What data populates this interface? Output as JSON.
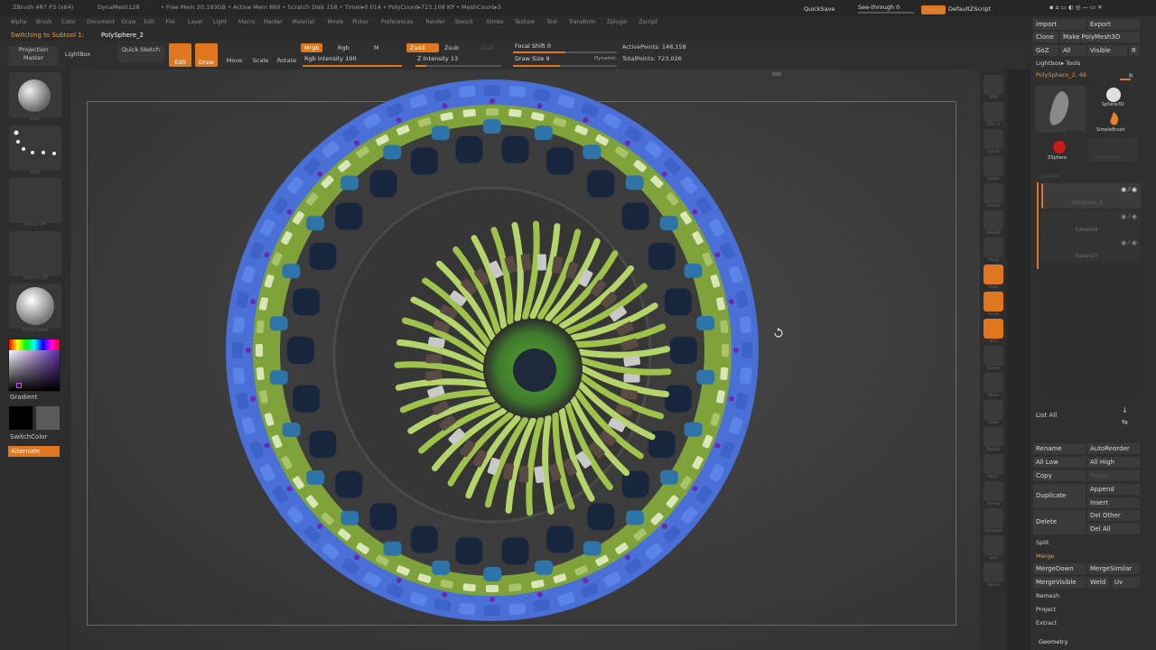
{
  "titlebar": {
    "app": "ZBrush 4R7 P3 (x64)",
    "dynamesh": "DynaMesh128",
    "free_mem": "• Free Mem 20.193GB • Active Mem 860 • Scratch Disk 158 • Timer▸0.014 • PolyCount▸723.108 KP • MeshCount▸3",
    "quicksave": "QuickSave",
    "see_through": "See-through 0",
    "menus": "Menus",
    "script": "DefaultZScript"
  },
  "menubar": [
    "Alpha",
    "Brush",
    "Color",
    "Document",
    "Draw",
    "Edit",
    "File",
    "Layer",
    "Light",
    "Macro",
    "Marker",
    "Material",
    "Movie",
    "Picker",
    "Preferences",
    "Render",
    "Stencil",
    "Stroke",
    "Texture",
    "Tool",
    "Transform",
    "Zplugin",
    "Zscript"
  ],
  "status": {
    "prefix": "Switching to Subtool 1:",
    "name": "PolySphere_2"
  },
  "toolbar": {
    "projection_master": "Projection Master",
    "lightbox": "LightBox",
    "quick_sketch": "Quick Sketch",
    "edit": "Edit",
    "draw": "Draw",
    "move": "Move",
    "scale": "Scale",
    "rotate": "Rotate",
    "mrgb": "Mrgb",
    "rgb": "Rgb",
    "m": "M",
    "rgb_intensity": "Rgb Intensity 100",
    "zadd": "Zadd",
    "zsub": "Zsub",
    "zcut": "Zcut",
    "z_intensity": "Z Intensity 13",
    "focal_shift": "Focal Shift 0",
    "draw_size": "Draw Size 9",
    "dynamic": "Dynamic",
    "active_points": "ActivePoints: 148,158",
    "total_points": "TotalPoints: 723,026",
    "rgb_intensity_level": 1.0,
    "z_intensity_level": 0.13,
    "focal_shift_level": 0.5,
    "draw_size_level": 0.45
  },
  "leftshelf": {
    "brush_label": "Clay",
    "stroke_label": "Dots",
    "alpha_label": "Alpha Off",
    "texture_label": "Texture Off",
    "material_label": "SkinShade4",
    "gradient": "Gradient",
    "switch_color": "SwitchColor",
    "alternate": "Alternate"
  },
  "rightshelf": [
    "BPR",
    "SPix 3",
    "Scroll",
    "Zoom",
    "Actual",
    "AAHalf",
    "Persp",
    "Floor",
    "Local",
    "XYZ",
    "Frame",
    "Move",
    "Scale",
    "Rotate",
    "PolyF",
    "Transp",
    "Dynamic",
    "Solo",
    "Xpose"
  ],
  "tray": {
    "import": "Import",
    "export": "Export",
    "clone": "Clone",
    "make_polymesh": "Make PolyMesh3D",
    "goz": "GoZ",
    "all": "All",
    "visible": "Visible",
    "r": "R",
    "lightbox_tools": "Lightbox▸ Tools",
    "current_tool": "PolySphere_2. 48",
    "tools": [
      "PolySphere_2",
      "Sphere3D",
      "SimpleBrush",
      "ZSphere",
      "PolySphere_2"
    ],
    "subtool_title": "SubTool",
    "subtools": [
      "PolySphere_2",
      "Extract28",
      "Extract27"
    ],
    "list_all": "List All",
    "rename": "Rename",
    "auto_reorder": "AutoReorder",
    "all_low": "All Low",
    "all_high": "All High",
    "copy": "Copy",
    "paste": "Paste",
    "duplicate": "Duplicate",
    "append": "Append",
    "insert": "Insert",
    "delete": "Delete",
    "del_other": "Del Other",
    "del_all": "Del All",
    "split": "Split",
    "merge": "Merge",
    "merge_down": "MergeDown",
    "merge_similar": "MergeSimilar",
    "merge_visible": "MergeVisible",
    "weld": "Weld",
    "uv": "Uv",
    "remesh": "Remesh",
    "project": "Project",
    "extract": "Extract",
    "geometry": "Geometry"
  },
  "colors": {
    "accent": "#e0761d",
    "panel": "#2f2f2f",
    "frame": "#6b6b6b"
  }
}
